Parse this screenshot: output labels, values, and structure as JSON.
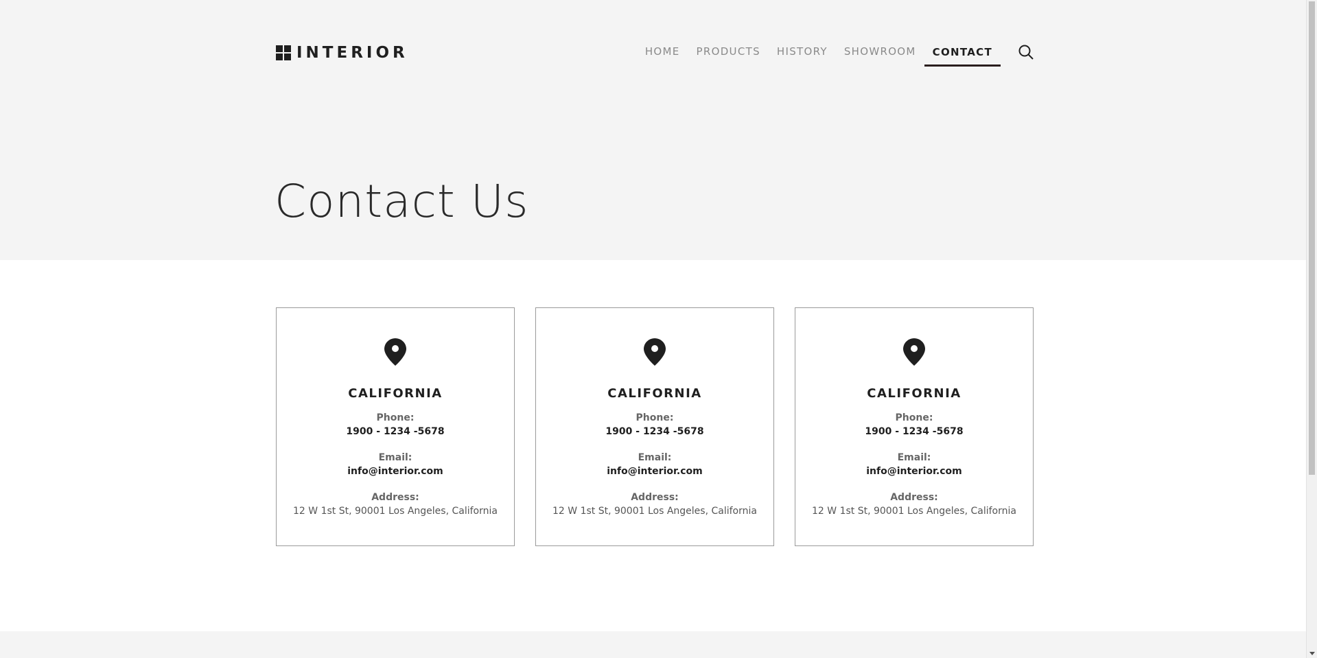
{
  "header": {
    "logo_text": "INTERIOR",
    "nav": [
      {
        "label": "HOME",
        "active": false
      },
      {
        "label": "PRODUCTS",
        "active": false
      },
      {
        "label": "HISTORY",
        "active": false
      },
      {
        "label": "SHOWROOM",
        "active": false
      },
      {
        "label": "CONTACT",
        "active": true
      }
    ],
    "search_icon": "search-icon"
  },
  "hero": {
    "title": "Contact Us"
  },
  "cards": [
    {
      "icon": "map-pin-icon",
      "title": "CALIFORNIA",
      "phone_label": "Phone:",
      "phone": "1900 - 1234 -5678",
      "email_label": "Email:",
      "email": "info@interior.com",
      "address_label": "Address:",
      "address": "12 W 1st St, 90001 Los Angeles, California"
    },
    {
      "icon": "map-pin-icon",
      "title": "CALIFORNIA",
      "phone_label": "Phone:",
      "phone": "1900 - 1234 -5678",
      "email_label": "Email:",
      "email": "info@interior.com",
      "address_label": "Address:",
      "address": "12 W 1st St, 90001 Los Angeles, California"
    },
    {
      "icon": "map-pin-icon",
      "title": "CALIFORNIA",
      "phone_label": "Phone:",
      "phone": "1900 - 1234 -5678",
      "email_label": "Email:",
      "email": "info@interior.com",
      "address_label": "Address:",
      "address": "12 W 1st St, 90001 Los Angeles, California"
    }
  ],
  "colors": {
    "hero_background": "#f4f4f4",
    "text_dark": "#1f1f1f",
    "nav_inactive": "#8a8a8a",
    "active_underline": "#2a1d1d",
    "card_border": "#9a9a9a"
  }
}
